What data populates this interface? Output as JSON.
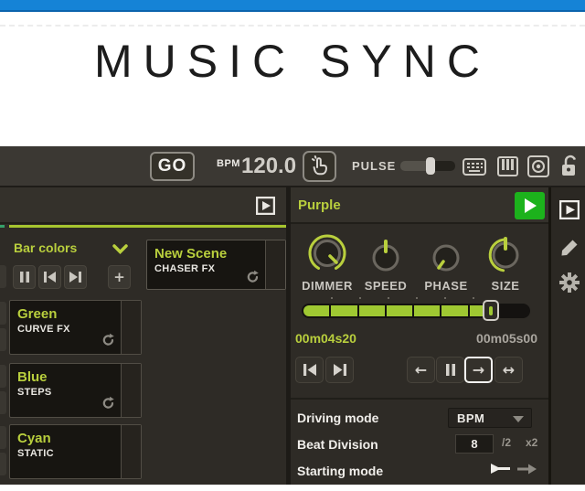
{
  "title": "MUSIC SYNC",
  "colors": {
    "accent_lime": "#b9cf3d",
    "progress_lime": "#9fc832",
    "play_green": "#1cb21c",
    "top_bar_blue": "#1583d6"
  },
  "toolbar": {
    "go_label": "GO",
    "bpm_label": "BPM",
    "bpm_value": "120.0",
    "pulse_label": "PULSE",
    "pulse_percent": 55
  },
  "left_panel": {
    "group_name": "Bar colors",
    "new_scene": {
      "title": "New Scene",
      "subtitle": "CHASER FX"
    },
    "scenes": [
      {
        "title": "Green",
        "subtitle": "CURVE FX"
      },
      {
        "title": "Blue",
        "subtitle": "STEPS"
      },
      {
        "title": "Cyan",
        "subtitle": "STATIC"
      }
    ]
  },
  "right_panel": {
    "scene_name": "Purple",
    "knobs": [
      {
        "label": "DIMMER"
      },
      {
        "label": "SPEED"
      },
      {
        "label": "PHASE"
      },
      {
        "label": "SIZE"
      }
    ],
    "progress_percent": 84,
    "time_elapsed": "00m04s20",
    "time_total": "00m05s00",
    "driving_mode": {
      "label": "Driving mode",
      "value": "BPM"
    },
    "beat_division": {
      "label": "Beat Division",
      "value": "8",
      "half_label": "/2",
      "double_label": "x2"
    },
    "starting_mode": {
      "label": "Starting mode"
    }
  },
  "glyphs": {
    "arrow_left": "←",
    "arrow_right": "→",
    "arrow_both": "↔",
    "plus": "+"
  }
}
